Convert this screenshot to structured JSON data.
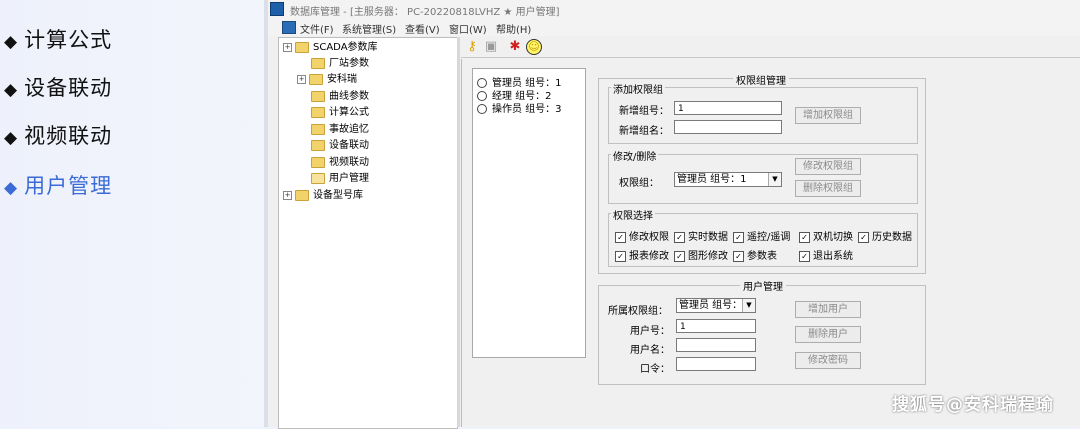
{
  "slide": {
    "items": [
      {
        "label": "计算公式",
        "active": false
      },
      {
        "label": "设备联动",
        "active": false
      },
      {
        "label": "视频联动",
        "active": false
      },
      {
        "label": "用户管理",
        "active": true
      }
    ],
    "bullet": "◆"
  },
  "window": {
    "title": "数据库管理 - [主服务器：  PC-20220818LVHZ ★ 用户管理]",
    "menu": [
      "文件(F)",
      "系统管理(S)",
      "查看(V)",
      "窗口(W)",
      "帮助(H)"
    ]
  },
  "tree": {
    "root": "SCADA参数库",
    "children": [
      "厂站参数",
      "安科瑞",
      "曲线参数",
      "计算公式",
      "事故追忆",
      "设备联动",
      "视频联动",
      "用户管理"
    ],
    "sibling": "设备型号库",
    "expander": "+"
  },
  "toolbar": {
    "icons": [
      "key-icon",
      "lock-icon",
      "run-icon",
      "smiley-icon"
    ]
  },
  "groups": [
    {
      "name": "管理员",
      "group_label": "组号：1"
    },
    {
      "name": "经理",
      "group_label": "组号：2"
    },
    {
      "name": "操作员",
      "group_label": "组号：3"
    }
  ],
  "perm": {
    "title": "权限组管理",
    "add": {
      "legend": "添加权限组",
      "new_id_label": "新增组号：",
      "new_id_value": "1",
      "new_name_label": "新增组名：",
      "new_name_value": "",
      "button": "增加权限组"
    },
    "edit": {
      "legend": "修改/删除",
      "group_label": "权限组：",
      "group_value": "管理员  组号：1",
      "modify_button": "修改权限组",
      "delete_button": "删除权限组"
    },
    "select": {
      "legend": "权限选择",
      "row1": [
        "修改权限",
        "实时数据",
        "遥控/遥调",
        "双机切换",
        "历史数据"
      ],
      "row2": [
        "报表修改",
        "图形修改",
        "参数表",
        "退出系统"
      ],
      "check": "✓"
    }
  },
  "user": {
    "title": "用户管理",
    "group_label": "所属权限组：",
    "group_value": "管理员  组号：",
    "id_label": "用户号：",
    "id_value": "1",
    "name_label": "用户名：",
    "name_value": "",
    "pwd_label": "口令：",
    "pwd_value": "",
    "add_button": "增加用户",
    "delete_button": "删除用户",
    "pwd_button": "修改密码"
  },
  "watermark": "搜狐号@安科瑞程瑜"
}
